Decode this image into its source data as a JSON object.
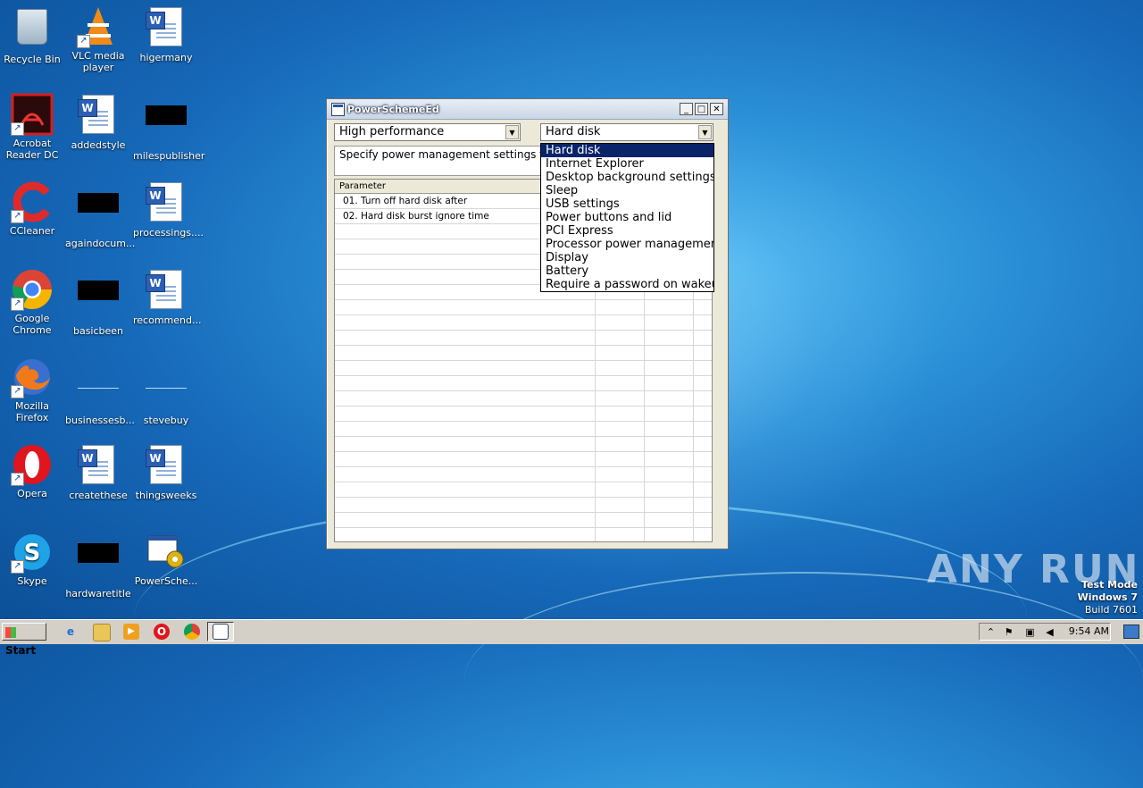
{
  "desktop": {
    "icons": [
      {
        "label": "Recycle Bin"
      },
      {
        "label": "VLC media player"
      },
      {
        "label": "higermany"
      },
      {
        "label": "Acrobat Reader DC"
      },
      {
        "label": "addedstyle"
      },
      {
        "label": "milespublisher"
      },
      {
        "label": "CCleaner"
      },
      {
        "label": "againdocum..."
      },
      {
        "label": "processings...."
      },
      {
        "label": "Google Chrome"
      },
      {
        "label": "basicbeen"
      },
      {
        "label": "recommend..."
      },
      {
        "label": "Mozilla Firefox"
      },
      {
        "label": "businessesb..."
      },
      {
        "label": "stevebuy"
      },
      {
        "label": "Opera"
      },
      {
        "label": "createthese"
      },
      {
        "label": "thingsweeks"
      },
      {
        "label": "Skype"
      },
      {
        "label": "hardwaretitle"
      },
      {
        "label": "PowerSche..."
      }
    ]
  },
  "window": {
    "title": "PowerSchemeEd",
    "scheme_combo": {
      "value": "High performance"
    },
    "category_combo": {
      "value": "Hard disk"
    },
    "description": "Specify power management settings for",
    "grid": {
      "header": "Parameter",
      "rows": [
        "01. Turn off hard disk after",
        "02. Hard disk burst ignore time"
      ]
    },
    "dropdown": {
      "items": [
        "Hard disk",
        "Internet Explorer",
        "Desktop background settings",
        "Sleep",
        "USB settings",
        "Power buttons and lid",
        "PCI Express",
        "Processor power management",
        "Display",
        "Battery",
        "Require a password on wakeup"
      ],
      "selected_index": 0
    }
  },
  "watermark": {
    "brand": "ANY RUN",
    "test_mode": "Test Mode",
    "os": "Windows 7",
    "build": "Build 7601"
  },
  "taskbar": {
    "start_label": "Start",
    "clock": "9:54 AM"
  },
  "colors": {
    "selection": "#0a246a",
    "wallpaper": "#1668b8"
  }
}
